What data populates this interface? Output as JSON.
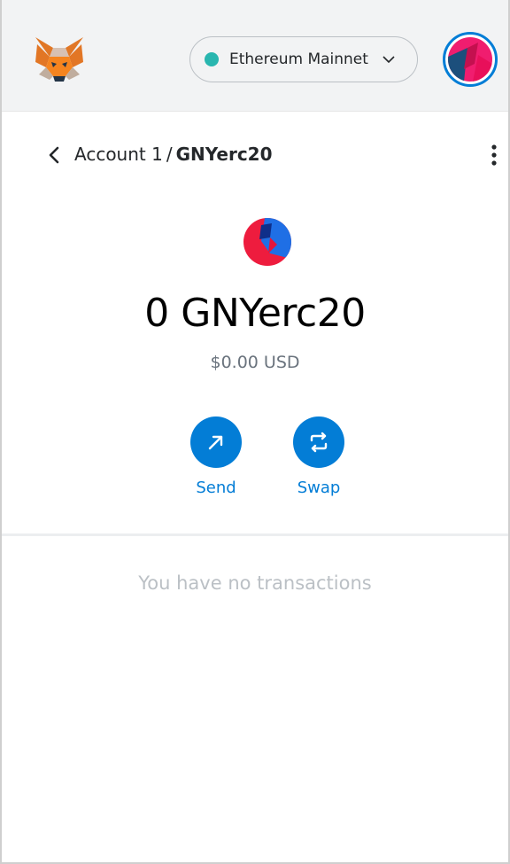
{
  "header": {
    "network": {
      "label": "Ethereum Mainnet",
      "status_color": "#29b6af"
    },
    "logo_icon": "fox-logo-icon",
    "avatar_icon": "account-identicon"
  },
  "breadcrumb": {
    "account": "Account 1",
    "separator": "/",
    "token": "GNYerc20"
  },
  "asset": {
    "icon": "token-identicon",
    "balance": "0 GNYerc20",
    "fiat": "$0.00 USD"
  },
  "actions": [
    {
      "label": "Send",
      "icon": "arrow-up-right-icon"
    },
    {
      "label": "Swap",
      "icon": "swap-arrows-icon"
    }
  ],
  "transactions": {
    "empty_message": "You have no transactions"
  },
  "colors": {
    "accent": "#037dd6",
    "header_bg": "#f2f3f4",
    "muted_text": "#bbc0c5"
  }
}
